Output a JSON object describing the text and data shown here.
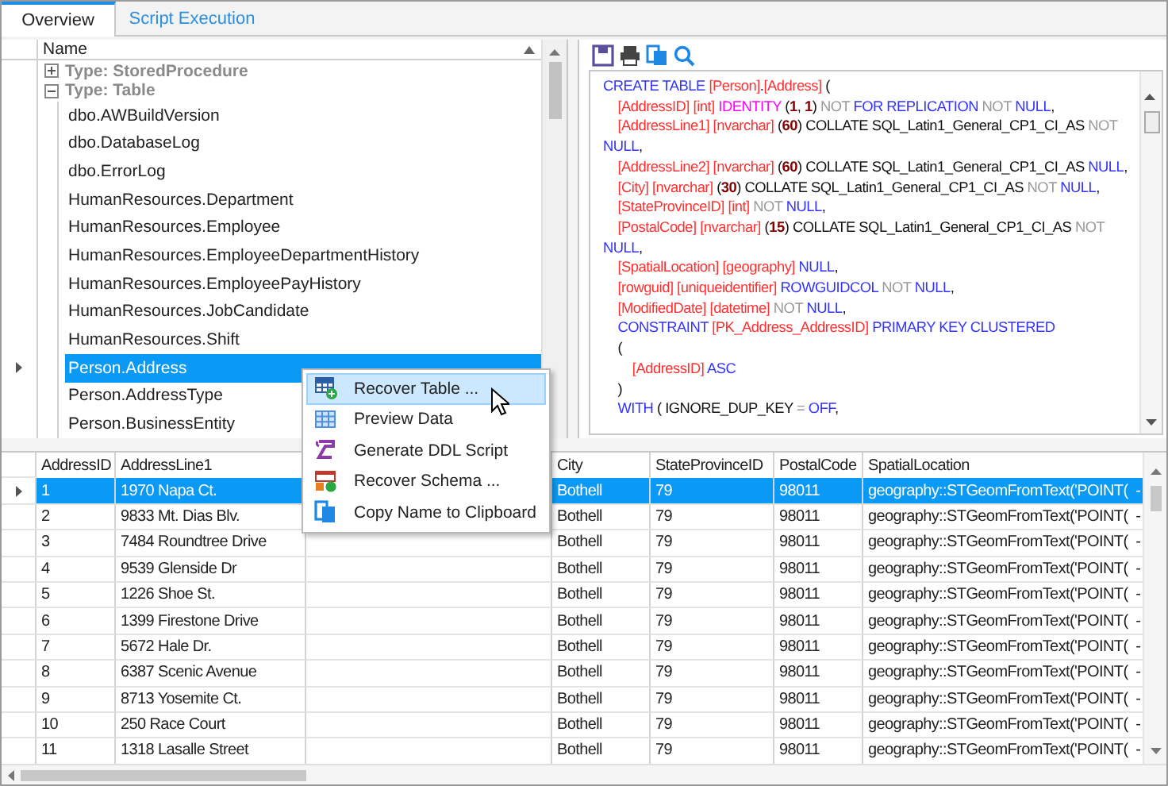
{
  "tabs": [
    {
      "label": "Overview",
      "selected": true
    },
    {
      "label": "Script Execution",
      "selected": false
    }
  ],
  "tree": {
    "column": "Name",
    "groups": [
      {
        "label": "Type: StoredProcedure",
        "expanded": false
      },
      {
        "label": "Type: Table",
        "expanded": true,
        "children": [
          {
            "label": "dbo.AWBuildVersion",
            "selected": false
          },
          {
            "label": "dbo.DatabaseLog",
            "selected": false
          },
          {
            "label": "dbo.ErrorLog",
            "selected": false
          },
          {
            "label": "HumanResources.Department",
            "selected": false
          },
          {
            "label": "HumanResources.Employee",
            "selected": false
          },
          {
            "label": "HumanResources.EmployeeDepartmentHistory",
            "selected": false
          },
          {
            "label": "HumanResources.EmployeePayHistory",
            "selected": false
          },
          {
            "label": "HumanResources.JobCandidate",
            "selected": false
          },
          {
            "label": "HumanResources.Shift",
            "selected": false
          },
          {
            "label": "Person.Address",
            "selected": true
          },
          {
            "label": "Person.AddressType",
            "selected": false
          },
          {
            "label": "Person.BusinessEntity",
            "selected": false
          }
        ]
      }
    ]
  },
  "script": {
    "lines": [
      [
        {
          "kind": "kw",
          "text": "CREATE TABLE "
        },
        {
          "kind": "id",
          "text": "[Person]"
        },
        {
          "kind": "plain",
          "text": "."
        },
        {
          "kind": "id",
          "text": "[Address]"
        },
        {
          "kind": "plain",
          "text": " ("
        }
      ],
      [
        {
          "kind": "id",
          "text": "    [AddressID] [int] "
        },
        {
          "kind": "fn",
          "text": "IDENTITY "
        },
        {
          "kind": "plain",
          "text": "("
        },
        {
          "kind": "num",
          "text": "1"
        },
        {
          "kind": "plain",
          "text": ", "
        },
        {
          "kind": "num",
          "text": "1"
        },
        {
          "kind": "plain",
          "text": ") "
        },
        {
          "kind": "op",
          "text": "NOT "
        },
        {
          "kind": "kw",
          "text": "FOR REPLICATION "
        },
        {
          "kind": "op",
          "text": "NOT "
        },
        {
          "kind": "kw",
          "text": "NULL"
        },
        {
          "kind": "plain",
          "text": ","
        }
      ],
      [
        {
          "kind": "id",
          "text": "    [AddressLine1] [nvarchar] "
        },
        {
          "kind": "plain",
          "text": "("
        },
        {
          "kind": "num",
          "text": "60"
        },
        {
          "kind": "plain",
          "text": ") COLLATE SQL_Latin1_General_CP1_CI_AS "
        },
        {
          "kind": "op",
          "text": "NOT "
        },
        {
          "kind": "kw",
          "text": "NULL"
        },
        {
          "kind": "plain",
          "text": ","
        }
      ],
      [
        {
          "kind": "id",
          "text": "    [AddressLine2] [nvarchar] "
        },
        {
          "kind": "plain",
          "text": "("
        },
        {
          "kind": "num",
          "text": "60"
        },
        {
          "kind": "plain",
          "text": ") COLLATE SQL_Latin1_General_CP1_CI_AS "
        },
        {
          "kind": "kw",
          "text": "NULL"
        },
        {
          "kind": "plain",
          "text": ","
        }
      ],
      [
        {
          "kind": "id",
          "text": "    [City] [nvarchar] "
        },
        {
          "kind": "plain",
          "text": "("
        },
        {
          "kind": "num",
          "text": "30"
        },
        {
          "kind": "plain",
          "text": ") COLLATE SQL_Latin1_General_CP1_CI_AS "
        },
        {
          "kind": "op",
          "text": "NOT "
        },
        {
          "kind": "kw",
          "text": "NULL"
        },
        {
          "kind": "plain",
          "text": ","
        }
      ],
      [
        {
          "kind": "id",
          "text": "    [StateProvinceID] [int] "
        },
        {
          "kind": "op",
          "text": "NOT "
        },
        {
          "kind": "kw",
          "text": "NULL"
        },
        {
          "kind": "plain",
          "text": ","
        }
      ],
      [
        {
          "kind": "id",
          "text": "    [PostalCode] [nvarchar] "
        },
        {
          "kind": "plain",
          "text": "("
        },
        {
          "kind": "num",
          "text": "15"
        },
        {
          "kind": "plain",
          "text": ") COLLATE SQL_Latin1_General_CP1_CI_AS "
        },
        {
          "kind": "op",
          "text": "NOT "
        },
        {
          "kind": "kw",
          "text": "NULL"
        },
        {
          "kind": "plain",
          "text": ","
        }
      ],
      [
        {
          "kind": "id",
          "text": "    [SpatialLocation] [geography] "
        },
        {
          "kind": "kw",
          "text": "NULL"
        },
        {
          "kind": "plain",
          "text": ","
        }
      ],
      [
        {
          "kind": "id",
          "text": "    [rowguid] [uniqueidentifier] "
        },
        {
          "kind": "kw",
          "text": "ROWGUIDCOL "
        },
        {
          "kind": "op",
          "text": "NOT "
        },
        {
          "kind": "kw",
          "text": "NULL"
        },
        {
          "kind": "plain",
          "text": ","
        }
      ],
      [
        {
          "kind": "id",
          "text": "    [ModifiedDate] [datetime] "
        },
        {
          "kind": "op",
          "text": "NOT "
        },
        {
          "kind": "kw",
          "text": "NULL"
        },
        {
          "kind": "plain",
          "text": ","
        }
      ],
      [
        {
          "kind": "kw",
          "text": "    CONSTRAINT "
        },
        {
          "kind": "id",
          "text": "[PK_Address_AddressID] "
        },
        {
          "kind": "kw",
          "text": "PRIMARY KEY CLUSTERED"
        }
      ],
      [
        {
          "kind": "plain",
          "text": "    ("
        }
      ],
      [
        {
          "kind": "id",
          "text": "        [AddressID] "
        },
        {
          "kind": "kw",
          "text": "ASC"
        }
      ],
      [
        {
          "kind": "plain",
          "text": "    )"
        }
      ],
      [
        {
          "kind": "kw",
          "text": "    WITH "
        },
        {
          "kind": "plain",
          "text": "( IGNORE_DUP_KEY "
        },
        {
          "kind": "op",
          "text": "= "
        },
        {
          "kind": "kw",
          "text": "OFF"
        },
        {
          "kind": "plain",
          "text": ","
        }
      ]
    ]
  },
  "grid": {
    "columns": [
      "AddressID",
      "AddressLine1",
      null,
      "City",
      "StateProvinceID",
      "PostalCode",
      "SpatialLocation"
    ],
    "rows": [
      {
        "selected": true,
        "cells": [
          "1",
          "1970 Napa Ct.",
          null,
          "Bothell",
          "79",
          "98011",
          "geography::STGeomFromText('POINT(  -"
        ]
      },
      {
        "selected": false,
        "cells": [
          "2",
          "9833 Mt. Dias Blv.",
          null,
          "Bothell",
          "79",
          "98011",
          "geography::STGeomFromText('POINT(  -"
        ]
      },
      {
        "selected": false,
        "cells": [
          "3",
          "7484 Roundtree Drive",
          null,
          "Bothell",
          "79",
          "98011",
          "geography::STGeomFromText('POINT(  -"
        ]
      },
      {
        "selected": false,
        "cells": [
          "4",
          "9539 Glenside Dr",
          null,
          "Bothell",
          "79",
          "98011",
          "geography::STGeomFromText('POINT(  -"
        ]
      },
      {
        "selected": false,
        "cells": [
          "5",
          "1226 Shoe St.",
          null,
          "Bothell",
          "79",
          "98011",
          "geography::STGeomFromText('POINT(  -"
        ]
      },
      {
        "selected": false,
        "cells": [
          "6",
          "1399 Firestone Drive",
          null,
          "Bothell",
          "79",
          "98011",
          "geography::STGeomFromText('POINT(  -"
        ]
      },
      {
        "selected": false,
        "cells": [
          "7",
          "5672 Hale Dr.",
          null,
          "Bothell",
          "79",
          "98011",
          "geography::STGeomFromText('POINT(  -"
        ]
      },
      {
        "selected": false,
        "cells": [
          "8",
          "6387 Scenic Avenue",
          null,
          "Bothell",
          "79",
          "98011",
          "geography::STGeomFromText('POINT(  -"
        ]
      },
      {
        "selected": false,
        "cells": [
          "9",
          "8713 Yosemite Ct.",
          null,
          "Bothell",
          "79",
          "98011",
          "geography::STGeomFromText('POINT(  -"
        ]
      },
      {
        "selected": false,
        "cells": [
          "10",
          "250 Race Court",
          null,
          "Bothell",
          "79",
          "98011",
          "geography::STGeomFromText('POINT(  -"
        ]
      },
      {
        "selected": false,
        "cells": [
          "11",
          "1318 Lasalle Street",
          null,
          "Bothell",
          "79",
          "98011",
          "geography::STGeomFromText('POINT(  -"
        ]
      }
    ]
  },
  "menu": {
    "items": [
      {
        "label": "Recover Table ...",
        "highlighted": true
      },
      {
        "label": "Preview Data",
        "highlighted": false
      },
      {
        "label": "Generate DDL Script",
        "highlighted": false
      },
      {
        "label": "Recover Schema ...",
        "highlighted": false
      },
      {
        "label": "Copy Name to Clipboard",
        "highlighted": false
      }
    ]
  }
}
